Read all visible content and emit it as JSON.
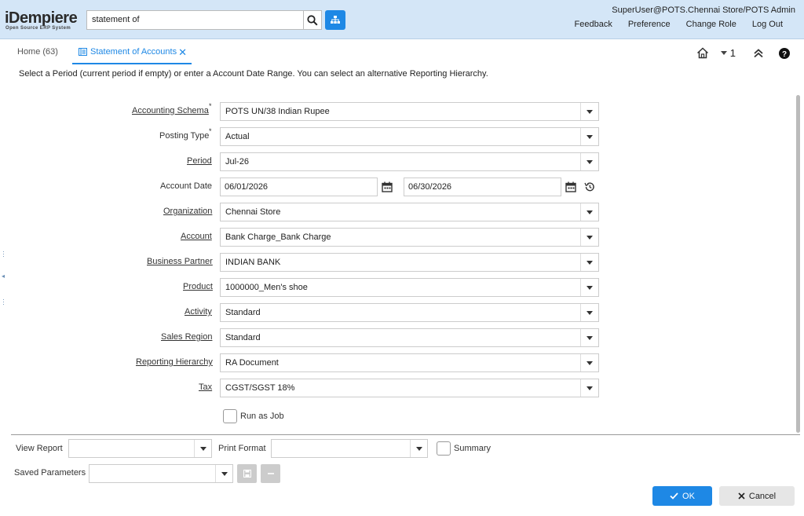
{
  "header": {
    "logo_main": "iDempiere",
    "logo_sub": "Open Source ERP System",
    "search_value": "statement of",
    "user": "SuperUser@POTS.Chennai Store/POTS Admin",
    "links": [
      "Feedback",
      "Preference",
      "Change Role",
      "Log Out"
    ]
  },
  "tabs": {
    "home": "Home (63)",
    "active": "Statement of Accounts",
    "count": "1"
  },
  "instructions": "Select a Period (current period if empty) or enter a Account Date Range. You can select an alternative Reporting Hierarchy.",
  "form": {
    "accounting_schema": {
      "label": "Accounting Schema",
      "value": "POTS UN/38 Indian Rupee"
    },
    "posting_type": {
      "label": "Posting Type",
      "value": "Actual"
    },
    "period": {
      "label": "Period",
      "value": "Jul-26"
    },
    "account_date": {
      "label": "Account Date",
      "from": "06/01/2026",
      "to": "06/30/2026"
    },
    "organization": {
      "label": "Organization",
      "value": "Chennai Store"
    },
    "account": {
      "label": "Account",
      "value": "Bank Charge_Bank Charge"
    },
    "business_partner": {
      "label": "Business Partner",
      "value": "INDIAN BANK"
    },
    "product": {
      "label": "Product",
      "value": "1000000_Men's shoe"
    },
    "activity": {
      "label": "Activity",
      "value": "Standard"
    },
    "sales_region": {
      "label": "Sales Region",
      "value": "Standard"
    },
    "reporting_hierarchy": {
      "label": "Reporting Hierarchy",
      "value": "RA Document"
    },
    "tax": {
      "label": "Tax",
      "value": "CGST/SGST 18%"
    },
    "required_mark": "*",
    "run_as_job": "Run as Job"
  },
  "bottom": {
    "view_report": "View Report",
    "print_format": "Print Format",
    "summary": "Summary",
    "saved_parameters": "Saved Parameters",
    "ok": "OK",
    "cancel": "Cancel"
  }
}
